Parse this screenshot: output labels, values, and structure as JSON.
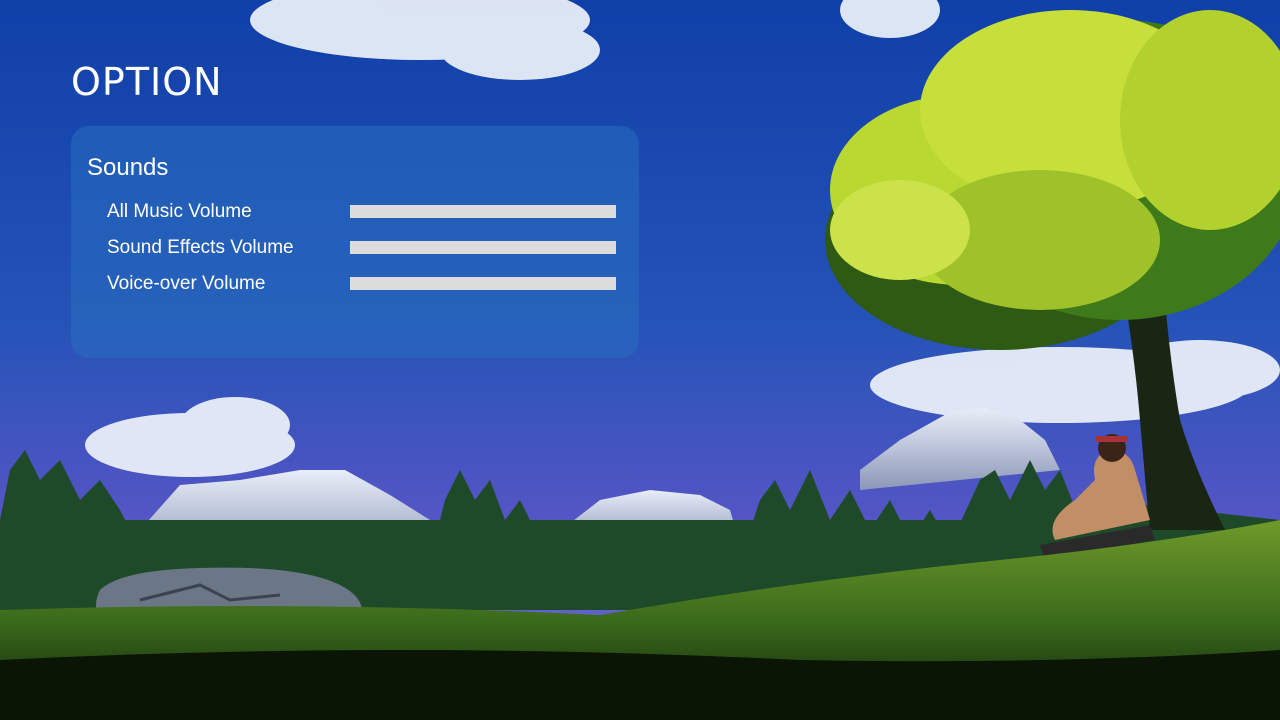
{
  "menu": {
    "title": "OPTION"
  },
  "sounds": {
    "heading": "Sounds",
    "items": [
      {
        "label": "All Music Volume",
        "level": 1.0
      },
      {
        "label": "Sound Effects Volume",
        "level": 1.0
      },
      {
        "label": "Voice-over Volume",
        "level": 1.0
      }
    ]
  },
  "colors": {
    "sky": "#1d4fb0",
    "panel": "#286ebe",
    "slider_fill": "#dcdcdc",
    "foliage": "#b9d832",
    "grass": "#2f5a18"
  }
}
